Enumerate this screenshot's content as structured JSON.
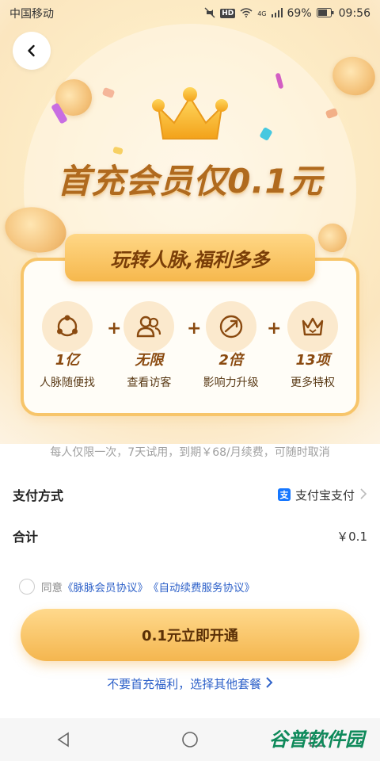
{
  "status_bar": {
    "carrier": "中国移动",
    "network": "4G",
    "battery": "69%",
    "time": "09:56",
    "icons": [
      "do-not-disturb-icon",
      "hd-icon",
      "wifi-icon",
      "signal-icon",
      "battery-icon"
    ]
  },
  "hero": {
    "headline": "首充会员仅0.1元",
    "tagline": "玩转人脉,福利多多"
  },
  "benefits": [
    {
      "value": "1亿",
      "label": "人脉随便找",
      "icon": "network-icon"
    },
    {
      "value": "无限",
      "label": "查看访客",
      "icon": "visitors-icon"
    },
    {
      "value": "2倍",
      "label": "影响力升级",
      "icon": "growth-icon"
    },
    {
      "value": "13项",
      "label": "更多特权",
      "icon": "crown-privilege-icon"
    }
  ],
  "note": "每人仅限一次，7天试用，到期￥68/月续费，可随时取消",
  "payment": {
    "label": "支付方式",
    "method": "支付宝支付"
  },
  "total": {
    "label": "合计",
    "amount": "￥0.1"
  },
  "agreement": {
    "prefix": "同意",
    "link1": "《脉脉会员协议》",
    "link2": "《自动续费服务协议》"
  },
  "cta": {
    "label": "0.1元立即开通"
  },
  "alt_link": {
    "label": "不要首充福利，选择其他套餐"
  },
  "watermark": {
    "text": "谷普软件园"
  },
  "colors": {
    "accent_gold": "#f4b64f",
    "link_blue": "#2f62c9",
    "headline_brown": "#b06a1e"
  }
}
